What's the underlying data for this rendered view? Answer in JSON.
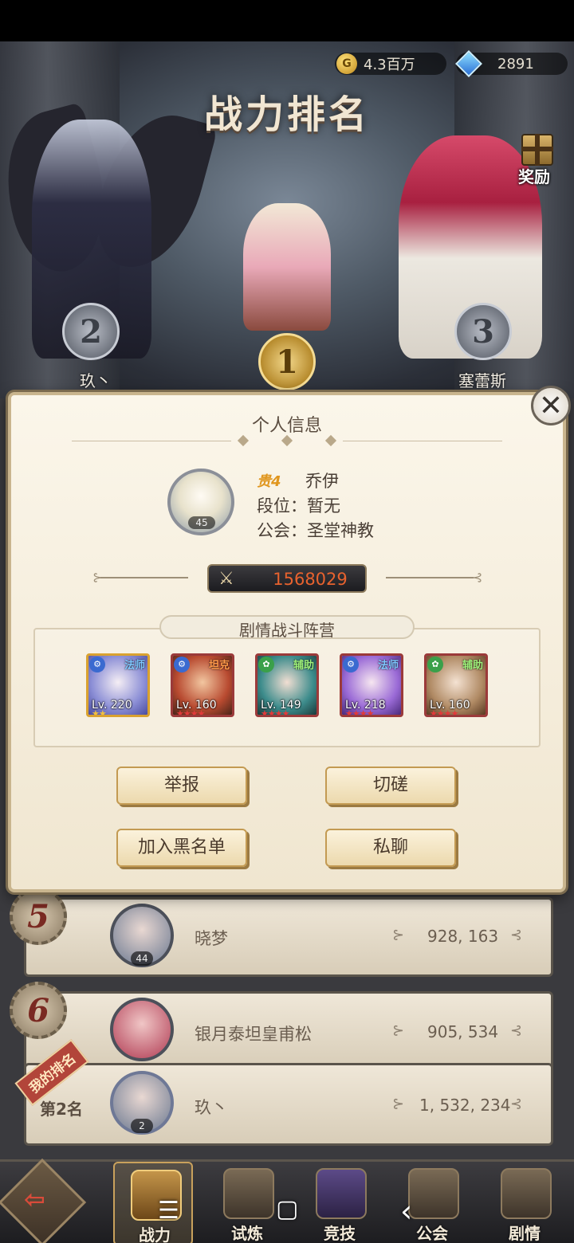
{
  "currency": {
    "gold_symbol": "G",
    "gold": "4.3百万",
    "gems": "2891"
  },
  "header": {
    "title": "战力排名",
    "reward_label": "奖励"
  },
  "podium": [
    {
      "rank": "2",
      "name": "玖丶"
    },
    {
      "rank": "1",
      "name": ""
    },
    {
      "rank": "3",
      "name": "塞蕾斯"
    }
  ],
  "modal": {
    "title": "个人信息",
    "close": "✕",
    "avatar_level": "45",
    "vip": "贵4",
    "name": "乔伊",
    "segment": "段位：暂无",
    "guild": "公会：圣堂神教",
    "power": "1568029",
    "camp_label": "剧情战斗阵营",
    "heroes": [
      {
        "level": "Lv. 220",
        "badge": "法师",
        "stars": "★★"
      },
      {
        "level": "Lv. 160",
        "badge": "坦克",
        "stars": "★★★★"
      },
      {
        "level": "Lv. 149",
        "badge": "辅助",
        "stars": "★★★★"
      },
      {
        "level": "Lv. 218",
        "badge": "法师",
        "stars": "★★★★"
      },
      {
        "level": "Lv. 160",
        "badge": "辅助",
        "stars": "★★★★"
      }
    ],
    "buttons": {
      "report": "举报",
      "duel": "切磋",
      "blacklist": "加入黑名单",
      "chat": "私聊"
    }
  },
  "rankings": [
    {
      "rank": "5",
      "name": "晓梦",
      "power": "928, 163",
      "avatar_level": "44"
    },
    {
      "rank": "6",
      "name": "银月泰坦皇甫松",
      "power": "905, 534",
      "avatar_level": ""
    }
  ],
  "my_rank": {
    "tag": "我的排名",
    "rank": "第2名",
    "name": "玖丶",
    "power": "1, 532, 234",
    "avatar_level": "2"
  },
  "nav": [
    {
      "label": "战力",
      "active": true
    },
    {
      "label": "试炼",
      "active": false
    },
    {
      "label": "竞技",
      "active": false
    },
    {
      "label": "公会",
      "active": false
    },
    {
      "label": "剧情",
      "active": false
    }
  ],
  "system": {
    "menu": "☰",
    "home": "▢",
    "back": "‹"
  }
}
